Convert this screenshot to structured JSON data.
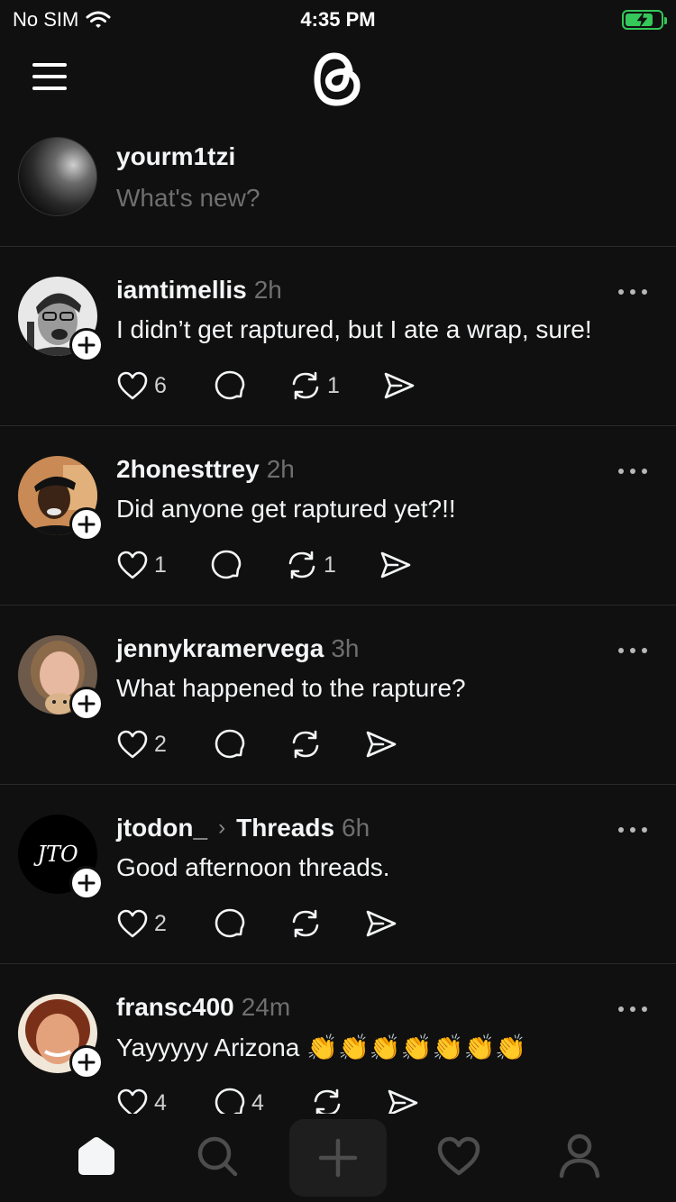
{
  "status": {
    "carrier": "No SIM",
    "time": "4:35 PM",
    "battery_color": "#34c759"
  },
  "nav": {
    "menu_icon": "menu-icon",
    "logo_icon": "threads-logo-icon"
  },
  "composer": {
    "username": "yourm1tzi",
    "placeholder": "What's new?"
  },
  "posts": [
    {
      "username": "iamtimellis",
      "time": "2h",
      "text": "I didn’t get raptured, but I ate a wrap, sure!",
      "likes": "6",
      "replies": "",
      "reposts": "1"
    },
    {
      "username": "2honesttrey",
      "time": "2h",
      "text": "Did anyone get raptured yet?!!",
      "likes": "1",
      "replies": "",
      "reposts": "1"
    },
    {
      "username": "jennykramervega",
      "time": "3h",
      "text": "What happened to the rapture?",
      "likes": "2",
      "replies": "",
      "reposts": ""
    },
    {
      "username": "jtodon_",
      "community": "Threads",
      "time": "6h",
      "text": "Good afternoon threads.",
      "likes": "2",
      "replies": "",
      "reposts": ""
    },
    {
      "username": "fransc400",
      "time": "24m",
      "text": "Yayyyyy Arizona 👏👏👏👏👏👏👏",
      "likes": "4",
      "replies": "4",
      "reposts": ""
    }
  ],
  "tabbar": {
    "items": [
      "home-icon",
      "search-icon",
      "create-icon",
      "activity-heart-icon",
      "profile-icon"
    ]
  }
}
